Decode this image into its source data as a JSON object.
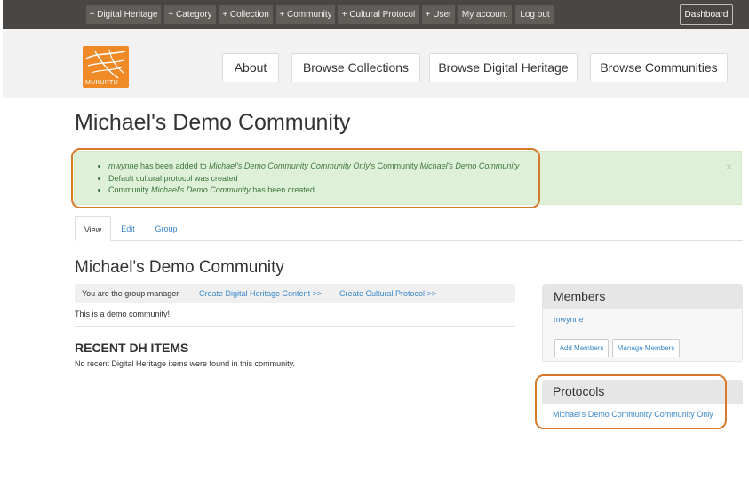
{
  "adminbar": {
    "items": [
      "+ Digital Heritage",
      "+ Category",
      "+ Collection",
      "+ Community",
      "+ Cultural Protocol",
      "+ User",
      "My account",
      "Log out"
    ],
    "dashboard": "Dashboard"
  },
  "header": {
    "logo_text": "MUKURTU",
    "nav": [
      "About",
      "Browse Collections",
      "Browse Digital Heritage",
      "Browse Communities"
    ]
  },
  "page_title": "Michael's Demo Community",
  "alert": {
    "messages": [
      {
        "parts": [
          "mwynne",
          " has been added to ",
          "Michael's Demo Community Community Only",
          "'s Community ",
          "Michael's Demo Community"
        ]
      },
      {
        "text": "Default cultural protocol was created"
      },
      {
        "parts": [
          "Community ",
          "Michael's Demo Community",
          " has been created."
        ]
      }
    ],
    "close": "×"
  },
  "tabs": [
    "View",
    "Edit",
    "Group"
  ],
  "content": {
    "title": "Michael's Demo Community",
    "manager_text": "You are the group manager",
    "create_dh": "Create Digital Heritage Content >>",
    "create_cp": "Create Cultural Protocol >>",
    "description": "This is a demo community!",
    "recent_title": "RECENT DH ITEMS",
    "recent_text": "No recent Digital Heritage items were found in this community."
  },
  "sidebar": {
    "members_title": "Members",
    "member": "mwynne",
    "add_members": "Add Members",
    "manage_members": "Manage Members",
    "protocols_title": "Protocols",
    "protocol": "Michael's Demo Community Community Only"
  },
  "colors": {
    "accent": "#3a87c9",
    "logo": "#ef8a27",
    "highlight": "#d97a2b",
    "alert_bg": "#dff0d8"
  }
}
